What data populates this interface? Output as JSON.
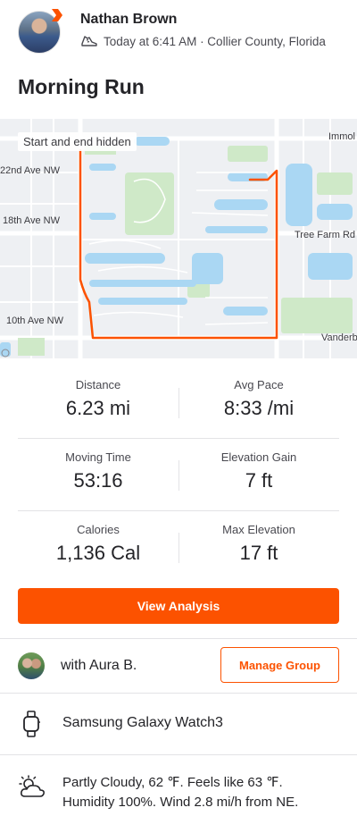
{
  "header": {
    "athlete_name": "Nathan Brown",
    "activity_meta": "Today at 6:41 AM · Collier County, Florida",
    "activity_icon": "shoe-icon"
  },
  "activity": {
    "title": "Morning Run"
  },
  "map": {
    "chip": "Start and end hidden",
    "labels": {
      "ave_22": "22nd Ave NW",
      "ave_18": "18th Ave NW",
      "ave_10": "10th Ave NW",
      "tree_farm": "Tree Farm Rd",
      "immok": "Immol",
      "vanderbilt": "Vanderb"
    },
    "route_color": "#fc5200"
  },
  "stats": [
    {
      "label": "Distance",
      "value": "6.23 mi"
    },
    {
      "label": "Avg Pace",
      "value": "8:33 /mi"
    },
    {
      "label": "Moving Time",
      "value": "53:16"
    },
    {
      "label": "Elevation Gain",
      "value": "7 ft"
    },
    {
      "label": "Calories",
      "value": "1,136 Cal"
    },
    {
      "label": "Max Elevation",
      "value": "17 ft"
    }
  ],
  "cta": {
    "label": "View Analysis"
  },
  "group": {
    "with_text": "with Aura B.",
    "manage_label": "Manage Group"
  },
  "device": {
    "name": "Samsung Galaxy Watch3",
    "icon": "watch-icon"
  },
  "weather": {
    "line1": "Partly Cloudy, 62 ℉. Feels like 63 ℉.",
    "line2": "Humidity 100%. Wind 2.8 mi/h from NE.",
    "icon": "partly-cloudy-icon"
  },
  "colors": {
    "accent": "#fc5200",
    "text": "#242428"
  }
}
